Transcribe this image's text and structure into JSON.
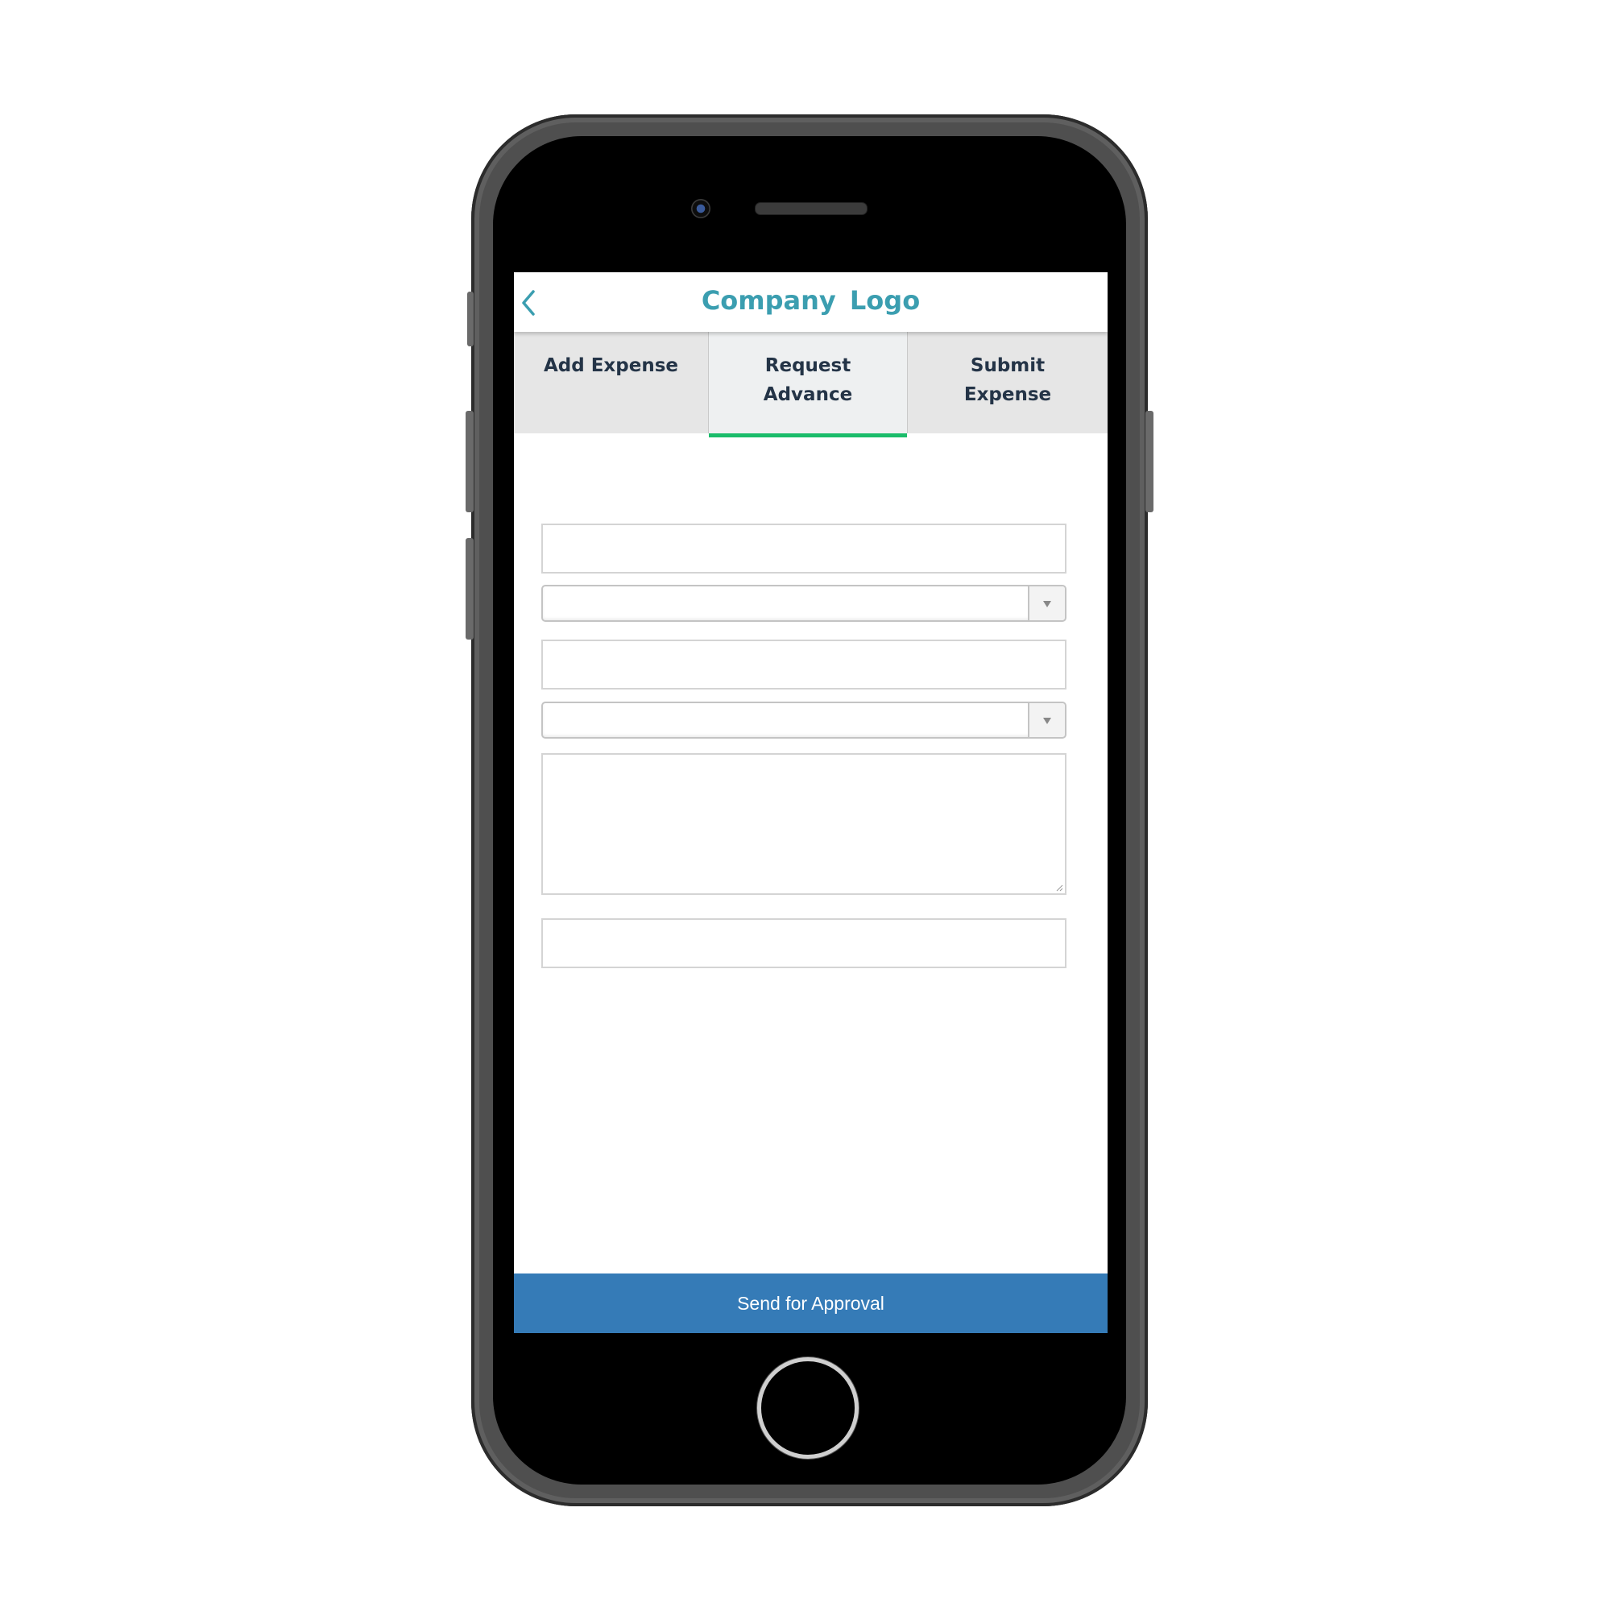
{
  "header": {
    "title": "Company  Logo",
    "back_icon": "chevron-left-icon"
  },
  "tabs": [
    {
      "label": "Add Expense",
      "active": false
    },
    {
      "label": "Request\nAdvance",
      "active": true
    },
    {
      "label": "Submit\nExpense",
      "active": false
    }
  ],
  "form": {
    "field_1": {
      "value": ""
    },
    "select_1": {
      "value": "",
      "icon": "dropdown-arrow-icon"
    },
    "field_2": {
      "value": ""
    },
    "select_2": {
      "value": "",
      "icon": "dropdown-arrow-icon"
    },
    "textarea": {
      "value": ""
    },
    "field_3": {
      "value": ""
    }
  },
  "footer": {
    "send_label": "Send for Approval"
  },
  "colors": {
    "accent": "#3b9eb0",
    "tab_indicator": "#1abc6a",
    "button": "#357bb7",
    "tab_bar": "#e6e6e6"
  }
}
